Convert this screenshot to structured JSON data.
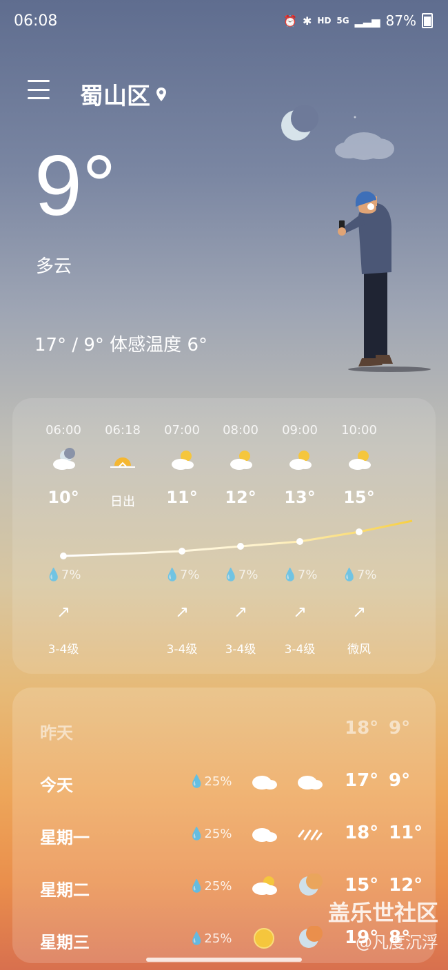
{
  "status": {
    "time": "06:08",
    "hd": "HD",
    "net": "5G",
    "battery": "87%"
  },
  "location": {
    "city": "蜀山区"
  },
  "current": {
    "temp": "9°",
    "condition": "多云",
    "range": "17° / 9° 体感温度 6°"
  },
  "hourly": [
    {
      "time": "06:00",
      "icon": "cloudy-night-icon",
      "temp": "10°",
      "rain": "7%",
      "wind": "3-4级"
    },
    {
      "time": "06:18",
      "icon": "sunrise-icon",
      "label": "日出"
    },
    {
      "time": "07:00",
      "icon": "partly-cloudy-icon",
      "temp": "11°",
      "rain": "7%",
      "wind": "3-4级"
    },
    {
      "time": "08:00",
      "icon": "partly-cloudy-icon",
      "temp": "12°",
      "rain": "7%",
      "wind": "3-4级"
    },
    {
      "time": "09:00",
      "icon": "partly-cloudy-icon",
      "temp": "13°",
      "rain": "7%",
      "wind": "3-4级"
    },
    {
      "time": "10:00",
      "icon": "partly-cloudy-icon",
      "temp": "15°",
      "rain": "7%",
      "wind": "微风"
    }
  ],
  "daily": [
    {
      "day": "昨天",
      "hi": "18°",
      "lo": "9°"
    },
    {
      "day": "今天",
      "rain": "25%",
      "icon_day": "cloud-icon",
      "icon_night": "cloud-icon",
      "hi": "17°",
      "lo": "9°"
    },
    {
      "day": "星期一",
      "rain": "25%",
      "icon_day": "cloud-icon",
      "icon_night": "rain-icon",
      "hi": "18°",
      "lo": "11°"
    },
    {
      "day": "星期二",
      "rain": "25%",
      "icon_day": "partly-cloudy-icon",
      "icon_night": "moon-icon",
      "hi": "15°",
      "lo": "12°"
    },
    {
      "day": "星期三",
      "rain": "25%",
      "icon_day": "sun-icon",
      "icon_night": "moon-icon",
      "hi": "19°",
      "lo": "8°"
    }
  ],
  "watermark": {
    "line1": "盖乐世社区",
    "line2": "@凡度沉浮"
  }
}
